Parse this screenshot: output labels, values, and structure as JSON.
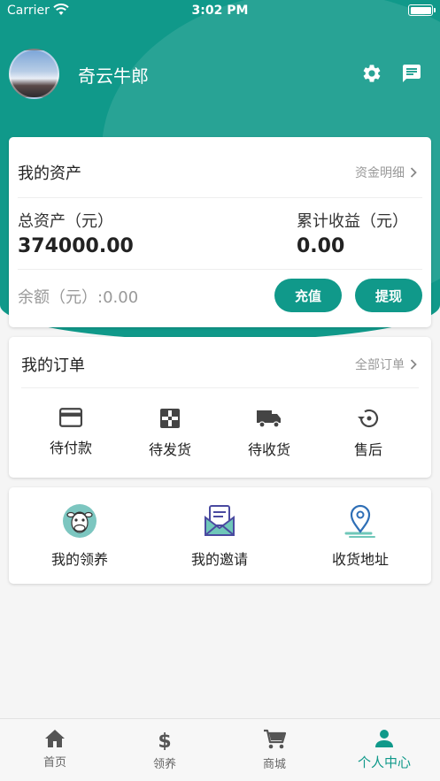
{
  "status_bar": {
    "carrier": "Carrier",
    "time": "3:02 PM"
  },
  "profile": {
    "username": "奇云牛郎"
  },
  "assets": {
    "title": "我的资产",
    "detail_link": "资金明细",
    "total_label": "总资产（元）",
    "total_value": "374000.00",
    "income_label": "累计收益（元）",
    "income_value": "0.00",
    "balance_text": "余额（元）:0.00",
    "recharge_label": "充值",
    "withdraw_label": "提现"
  },
  "orders": {
    "title": "我的订单",
    "all_link": "全部订单",
    "items": [
      {
        "label": "待付款",
        "icon": "credit-card-icon"
      },
      {
        "label": "待发货",
        "icon": "package-icon"
      },
      {
        "label": "待收货",
        "icon": "truck-icon"
      },
      {
        "label": "售后",
        "icon": "after-sale-icon"
      }
    ]
  },
  "services": {
    "items": [
      {
        "label": "我的领养",
        "icon": "cow-icon"
      },
      {
        "label": "我的邀请",
        "icon": "invite-mail-icon"
      },
      {
        "label": "收货地址",
        "icon": "location-pin-icon"
      }
    ]
  },
  "tab_bar": {
    "tabs": [
      {
        "label": "首页",
        "icon": "home-icon"
      },
      {
        "label": "领养",
        "icon": "dollar-icon"
      },
      {
        "label": "商城",
        "icon": "cart-icon"
      },
      {
        "label": "个人中心",
        "icon": "person-icon"
      }
    ],
    "active": "个人中心"
  },
  "colors": {
    "primary": "#10998a",
    "background": "#f5f5f5"
  }
}
